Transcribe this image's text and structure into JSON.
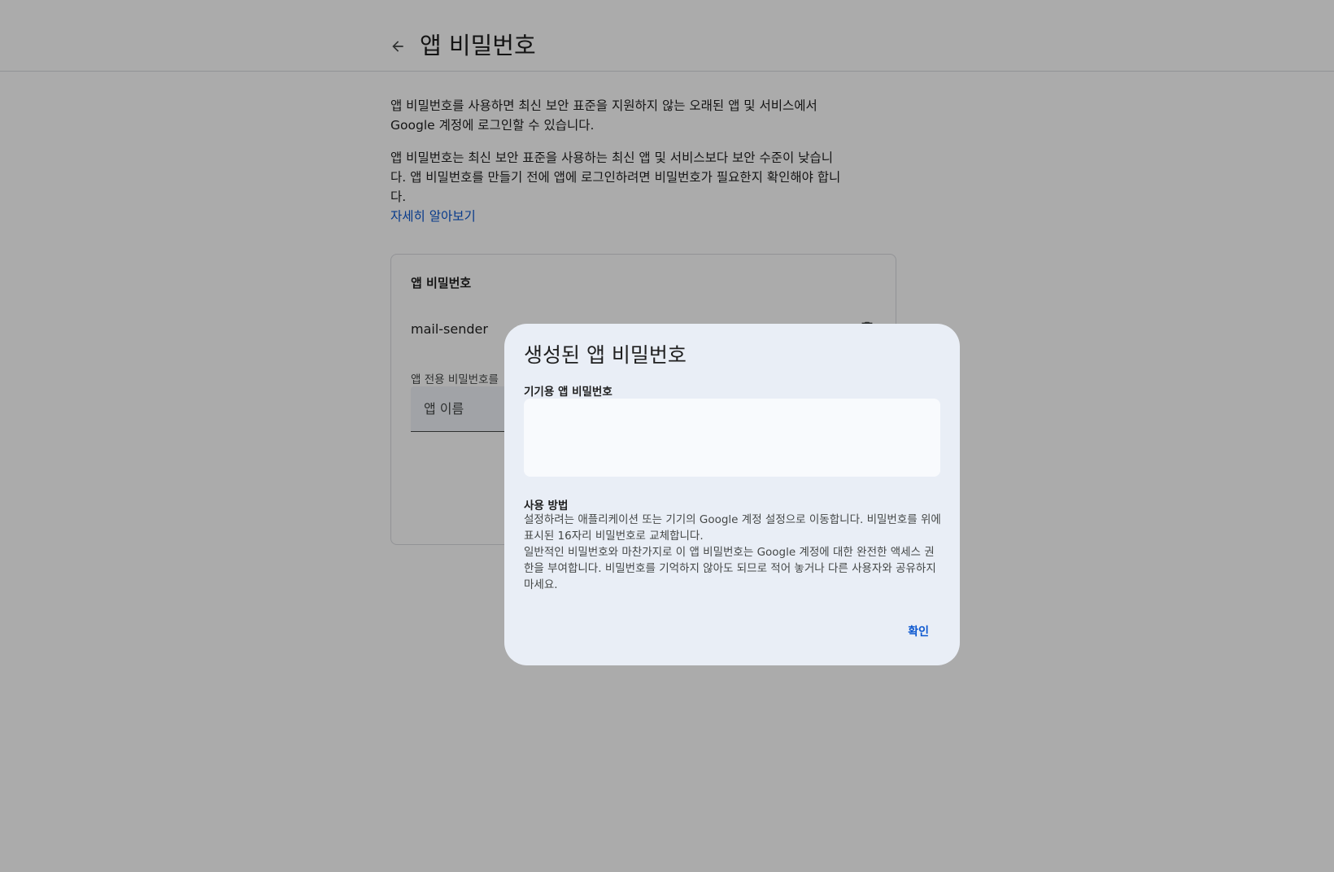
{
  "header": {
    "title": "앱 비밀번호"
  },
  "intro": {
    "paragraph1": "앱 비밀번호를 사용하면 최신 보안 표준을 지원하지 않는 오래된 앱 및 서비스에서 Google 계정에 로그인할 수 있습니다.",
    "paragraph2": "앱 비밀번호는 최신 보안 표준을 사용하는 최신 앱 및 서비스보다 보안 수준이 낮습니다. 앱 비밀번호를 만들기 전에 앱에 로그인하려면 비밀번호가 필요한지 확인해야 합니다.",
    "learn_more": "자세히 알아보기"
  },
  "card": {
    "title": "앱 비밀번호",
    "apps": [
      {
        "name": "mail-sender"
      }
    ],
    "create_label": "앱 전용 비밀번호를",
    "app_name_placeholder": "앱 이름"
  },
  "dialog": {
    "title": "생성된 앱 비밀번호",
    "password_label": "기기용 앱 비밀번호",
    "password_value": "",
    "usage_heading": "사용 방법",
    "usage_paragraph1": "설정하려는 애플리케이션 또는 기기의 Google 계정 설정으로 이동합니다. 비밀번호를 위에 표시된 16자리 비밀번호로 교체합니다.",
    "usage_paragraph2": "일반적인 비밀번호와 마찬가지로 이 앱 비밀번호는 Google 계정에 대한 완전한 액세스 권한을 부여합니다. 비밀번호를 기억하지 않아도 되므로 적어 놓거나 다른 사용자와 공유하지 마세요.",
    "confirm_label": "확인"
  },
  "colors": {
    "accent": "#0b57d0",
    "dialog_bg": "#e9eef6",
    "scrim": "rgba(0,0,0,0.33)"
  },
  "icons": {
    "back": "arrow-back-icon",
    "delete": "trash-icon"
  }
}
